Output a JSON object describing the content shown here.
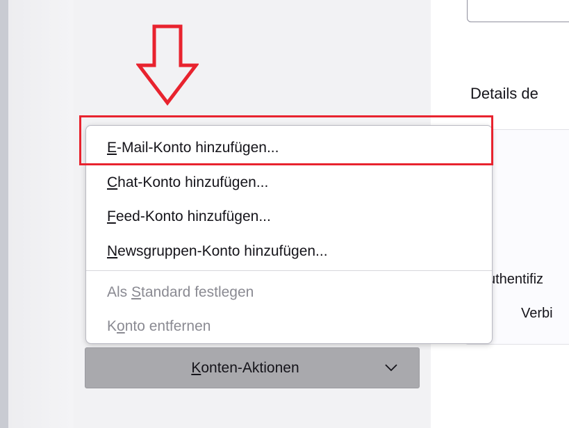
{
  "main": {
    "details_heading": "Details de",
    "auth_label": "uthentifiz",
    "connection_label": "Verbi"
  },
  "menu": {
    "items": [
      {
        "pre": "",
        "mnemonic": "E",
        "post": "-Mail-Konto hinzufügen...",
        "enabled": true
      },
      {
        "pre": "",
        "mnemonic": "C",
        "post": "hat-Konto hinzufügen...",
        "enabled": true
      },
      {
        "pre": "",
        "mnemonic": "F",
        "post": "eed-Konto hinzufügen...",
        "enabled": true
      },
      {
        "pre": "",
        "mnemonic": "N",
        "post": "ewsgruppen-Konto hinzufügen...",
        "enabled": true
      },
      {
        "pre": "Als ",
        "mnemonic": "S",
        "post": "tandard festlegen",
        "enabled": false
      },
      {
        "pre": "K",
        "mnemonic": "o",
        "post": "nto entfernen",
        "enabled": false
      }
    ]
  },
  "account_actions": {
    "pre": "",
    "mnemonic": "K",
    "post": "onten-Aktionen",
    "icon": "chevron-down-icon"
  },
  "annotation": {
    "arrow_color": "#e8232e",
    "highlight_color": "#e8232e"
  }
}
